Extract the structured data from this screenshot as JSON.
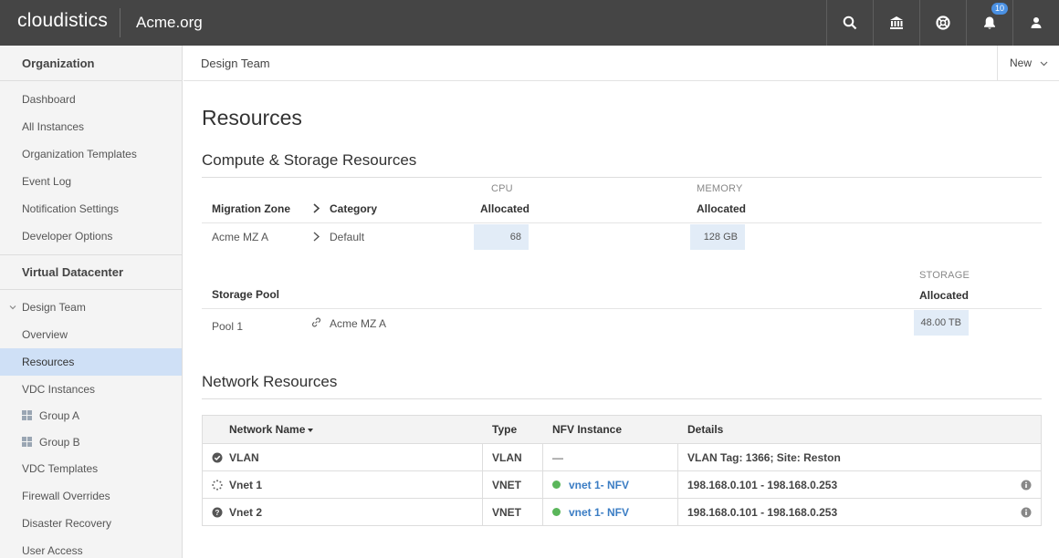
{
  "topbar": {
    "brand": "cloudistics",
    "org": "Acme.org",
    "notification_count": "10",
    "icons": [
      "search-icon",
      "bank-icon",
      "lifebuoy-icon",
      "bell-icon",
      "user-icon"
    ]
  },
  "sidebar": {
    "org_heading": "Organization",
    "org_items": [
      "Dashboard",
      "All Instances",
      "Organization Templates",
      "Event Log",
      "Notification Settings",
      "Developer Options"
    ],
    "vdc_heading": "Virtual Datacenter",
    "team": "Design Team",
    "vdc_items": {
      "overview": "Overview",
      "resources": "Resources",
      "instances": "VDC Instances",
      "group_a": "Group A",
      "group_b": "Group B",
      "templates": "VDC Templates",
      "firewall": "Firewall Overrides",
      "disaster": "Disaster Recovery",
      "access": "User Access"
    }
  },
  "subheader": {
    "title": "Design Team",
    "new_label": "New"
  },
  "main": {
    "title": "Resources",
    "compute": {
      "title": "Compute & Storage Resources",
      "cpu_label": "CPU",
      "memory_label": "MEMORY",
      "headers": {
        "zone": "Migration Zone",
        "category": "Category",
        "cpu_allocated": "Allocated",
        "mem_allocated": "Allocated"
      },
      "row": {
        "zone": "Acme MZ A",
        "category": "Default",
        "cpu": "68",
        "memory": "128 GB"
      },
      "storage_label": "STORAGE",
      "storage_headers": {
        "pool": "Storage Pool",
        "allocated": "Allocated"
      },
      "storage_row": {
        "pool": "Pool 1",
        "zone": "Acme MZ A",
        "allocated": "48.00 TB"
      }
    },
    "network": {
      "title": "Network Resources",
      "headers": {
        "name": "Network Name",
        "type": "Type",
        "nfv": "NFV Instance",
        "details": "Details"
      },
      "rows": [
        {
          "name": "VLAN",
          "type": "VLAN",
          "nfv": "—",
          "details": "VLAN Tag: 1366; Site: Reston",
          "status_icon": "check-circle-icon"
        },
        {
          "name": "Vnet 1",
          "type": "VNET",
          "nfv": "vnet 1- NFV",
          "details": "198.168.0.101 - 198.168.0.253",
          "status_icon": "spinner-icon"
        },
        {
          "name": "Vnet 2",
          "type": "VNET",
          "nfv": "vnet 1- NFV",
          "details": "198.168.0.101 - 198.168.0.253",
          "status_icon": "question-circle-icon"
        }
      ]
    }
  },
  "colors": {
    "topbar": "#454545",
    "accent": "#4a90e2",
    "active_item": "#cfe0f6",
    "status_green": "#5ab65a",
    "link": "#3b7dc4"
  }
}
